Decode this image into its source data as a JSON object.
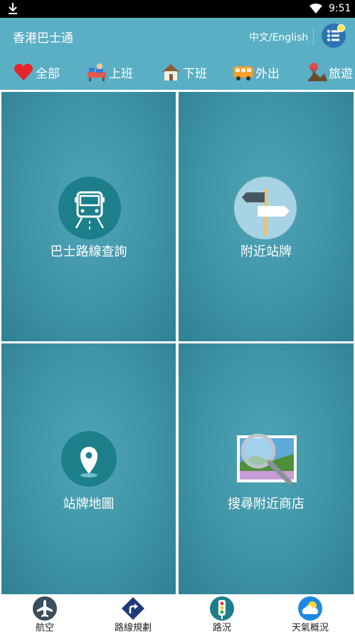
{
  "status_bar": {
    "time": "9:51"
  },
  "app_bar": {
    "title": "香港巴士通",
    "lang_toggle": "中文/English"
  },
  "categories": [
    {
      "label": "全部",
      "icon": "heart-icon"
    },
    {
      "label": "上班",
      "icon": "office-desk-icon"
    },
    {
      "label": "下班",
      "icon": "home-icon"
    },
    {
      "label": "外出",
      "icon": "bus-front-icon"
    },
    {
      "label": "旅遊",
      "icon": "hot-air-balloon-icon"
    }
  ],
  "tiles": [
    {
      "label": "巴士路線查詢",
      "icon": "bus-icon"
    },
    {
      "label": "附近站牌",
      "icon": "signpost-icon"
    },
    {
      "label": "站牌地圖",
      "icon": "map-pin-icon"
    },
    {
      "label": "搜尋附近商店",
      "icon": "magnifier-photo-icon"
    }
  ],
  "bottom_nav": [
    {
      "label": "航空",
      "icon": "airplane-icon"
    },
    {
      "label": "路線規劃",
      "icon": "route-turn-icon"
    },
    {
      "label": "路況",
      "icon": "traffic-light-icon"
    },
    {
      "label": "天氣概況",
      "icon": "weather-icon"
    }
  ],
  "colors": {
    "header": "#5aafc4",
    "tile": "#3e93a5",
    "menu_button": "#2d73b3"
  }
}
